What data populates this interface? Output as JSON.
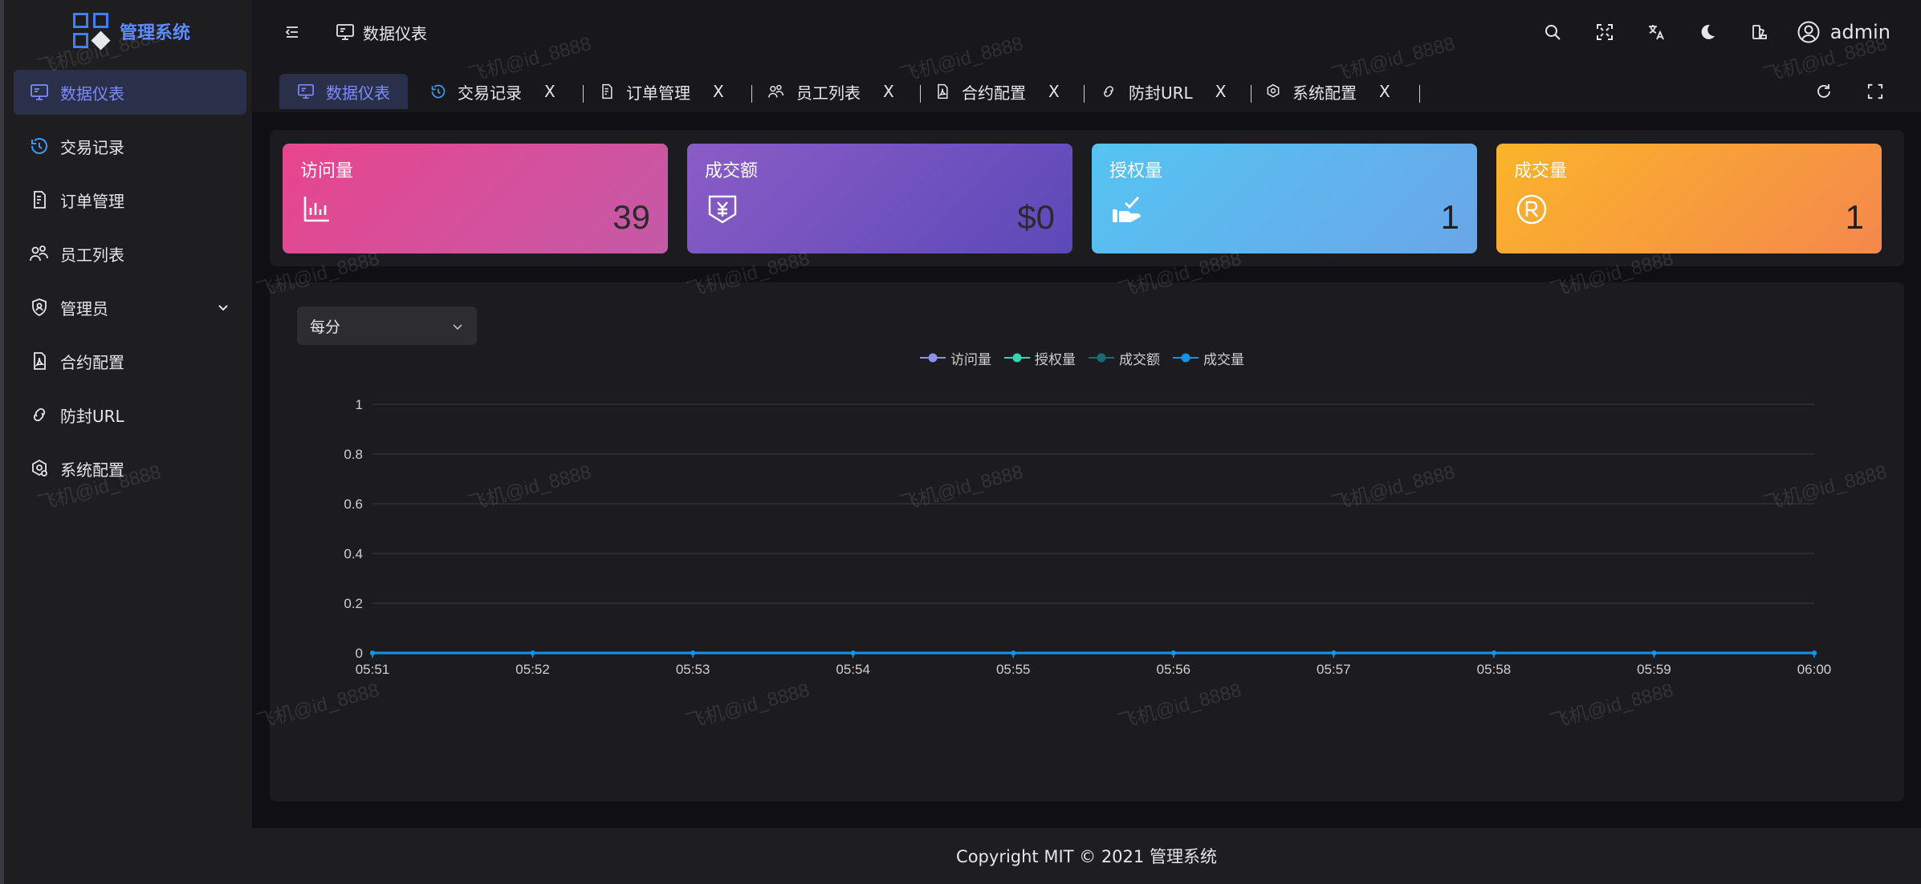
{
  "app": {
    "title": "管理系统"
  },
  "header": {
    "breadcrumb": "数据仪表",
    "username": "admin",
    "icons": [
      "menu-fold-icon",
      "monitor-icon",
      "search-icon",
      "fullscreen-icon",
      "translate-icon",
      "moon-icon",
      "theme-icon",
      "user-circle-icon"
    ]
  },
  "sidebar": {
    "items": [
      {
        "label": "数据仪表",
        "icon": "monitor-icon",
        "active": true
      },
      {
        "label": "交易记录",
        "icon": "clock-refresh-icon",
        "active": false
      },
      {
        "label": "订单管理",
        "icon": "receipt-icon",
        "active": false
      },
      {
        "label": "员工列表",
        "icon": "people-icon",
        "active": false
      },
      {
        "label": "管理员",
        "icon": "shield-user-icon",
        "active": false,
        "has_submenu": true
      },
      {
        "label": "合约配置",
        "icon": "pdf-file-icon",
        "active": false
      },
      {
        "label": "防封URL",
        "icon": "link-icon",
        "active": false
      },
      {
        "label": "系统配置",
        "icon": "settings-hex-icon",
        "active": false
      }
    ]
  },
  "tabs": [
    {
      "label": "数据仪表",
      "icon": "monitor-icon",
      "active": true,
      "closable": false
    },
    {
      "label": "交易记录",
      "icon": "clock-refresh-icon",
      "closable": true,
      "close": "X"
    },
    {
      "label": "订单管理",
      "icon": "receipt-icon",
      "closable": true,
      "close": "X"
    },
    {
      "label": "员工列表",
      "icon": "people-icon",
      "closable": true,
      "close": "X"
    },
    {
      "label": "合约配置",
      "icon": "pdf-file-icon",
      "closable": true,
      "close": "X"
    },
    {
      "label": "防封URL",
      "icon": "link-icon",
      "closable": true,
      "close": "X"
    },
    {
      "label": "系统配置",
      "icon": "settings-hex-icon",
      "closable": true,
      "close": "X"
    }
  ],
  "stats": [
    {
      "title": "访问量",
      "value": "39",
      "icon": "bar-chart-icon",
      "gradient": [
        "#e8458d",
        "#c45aa8"
      ]
    },
    {
      "title": "成交额",
      "value": "$0",
      "icon": "yuan-download-icon",
      "gradient": [
        "#8b5cc6",
        "#5b49b8"
      ]
    },
    {
      "title": "授权量",
      "value": "1",
      "icon": "hand-check-icon",
      "gradient": [
        "#55c4f2",
        "#6aa6e8"
      ]
    },
    {
      "title": "成交量",
      "value": "1",
      "icon": "registered-icon",
      "gradient": [
        "#fbb42a",
        "#f4884c"
      ]
    }
  ],
  "filter": {
    "selected": "每分"
  },
  "chart_data": {
    "type": "line",
    "x": [
      "05:51",
      "05:52",
      "05:53",
      "05:54",
      "05:55",
      "05:56",
      "05:57",
      "05:58",
      "05:59",
      "06:00"
    ],
    "yticks": [
      "0",
      "0.2",
      "0.4",
      "0.6",
      "0.8",
      "1"
    ],
    "ylim": [
      0,
      1
    ],
    "grid": true,
    "legend_position": "top-center",
    "series": [
      {
        "name": "访问量",
        "color": "#8a94f0",
        "values": [
          0,
          0,
          0,
          0,
          0,
          0,
          0,
          0,
          0,
          0
        ]
      },
      {
        "name": "授权量",
        "color": "#2fd6b8",
        "values": [
          0,
          0,
          0,
          0,
          0,
          0,
          0,
          0,
          0,
          0
        ]
      },
      {
        "name": "成交额",
        "color": "#1d6b72",
        "values": [
          0,
          0,
          0,
          0,
          0,
          0,
          0,
          0,
          0,
          0
        ]
      },
      {
        "name": "成交量",
        "color": "#1793e6",
        "values": [
          0,
          0,
          0,
          0,
          0,
          0,
          0,
          0,
          0,
          0
        ]
      }
    ]
  },
  "footer": {
    "text": "Copyright MIT © 2021 管理系统"
  },
  "watermark": "飞机@id_8888"
}
